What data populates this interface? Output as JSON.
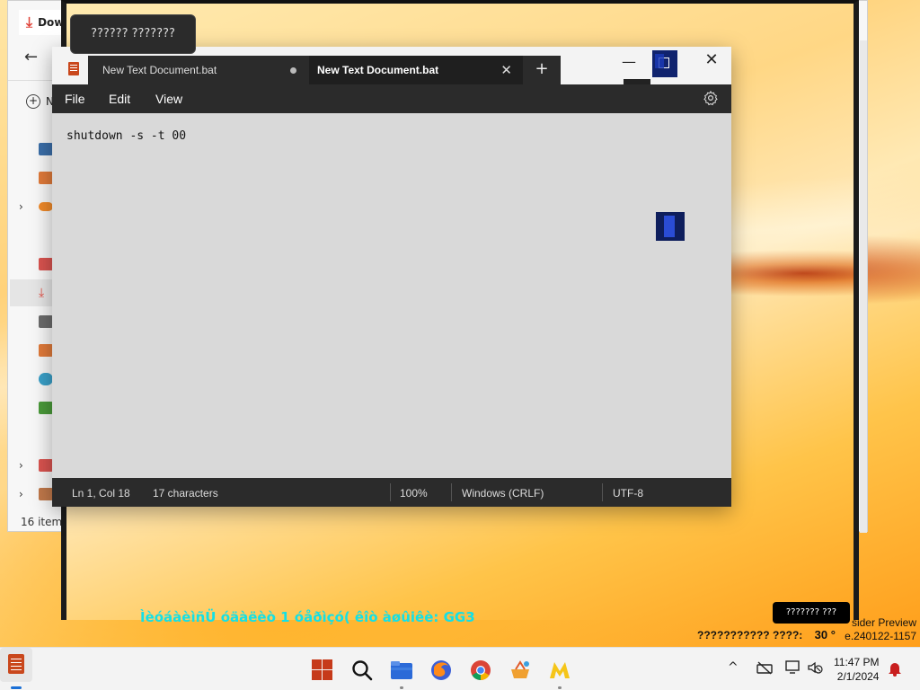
{
  "explorer": {
    "title": "Dow",
    "new_label": "N",
    "items_count": "16 items"
  },
  "tooltip": {
    "text": "?????? ???????"
  },
  "notepad": {
    "tabs": [
      {
        "label": "New Text Document.bat",
        "unsaved": true
      },
      {
        "label": "New Text Document.bat",
        "active": true
      }
    ],
    "menu": {
      "file": "File",
      "edit": "Edit",
      "view": "View"
    },
    "content": "shutdown -s -t 00",
    "status": {
      "position": "Ln 1, Col 18",
      "characters": "17 characters",
      "zoom": "100%",
      "line_ending": "Windows (CRLF)",
      "encoding": "UTF-8"
    }
  },
  "desktop": {
    "activation_text": "ÌèóáàèìñÜ óäàëèò 1 óåðìçó( êîò àøûiêè: GG3",
    "tray_tooltip": "??????? ???",
    "watermark_line1": "sider Preview",
    "watermark_line2": "e.240122-1157",
    "temp_label": "??????????? ????:",
    "temp_value": "30  °"
  },
  "taskbar": {
    "apps": [
      "start",
      "search",
      "file-explorer",
      "firefox",
      "chrome",
      "app",
      "app",
      "notepad"
    ],
    "clock_time": "11:47 PM",
    "clock_date": "2/1/2024"
  },
  "colors": {
    "accent": "#1a6fd6",
    "notepad_dark": "#2b2b2b",
    "activation_text": "#13e0e6",
    "notepad_icon": "#c9471c"
  }
}
